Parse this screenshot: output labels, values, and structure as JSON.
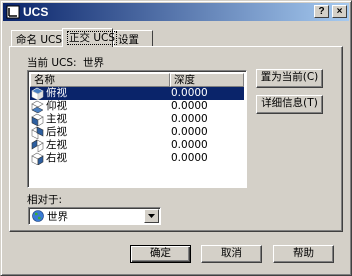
{
  "window": {
    "title": "UCS",
    "help_button": "?",
    "close_button": "×"
  },
  "tabs": [
    {
      "label": "命名 UCS"
    },
    {
      "label": "正交 UCS"
    },
    {
      "label": "设置"
    }
  ],
  "current_ucs": {
    "label": "当前 UCS:",
    "value": "世界"
  },
  "list": {
    "columns": {
      "name": "名称",
      "depth": "深度"
    },
    "rows": [
      {
        "name": "俯视",
        "depth": "0.0000",
        "icon": "top-view-icon"
      },
      {
        "name": "仰视",
        "depth": "0.0000",
        "icon": "bottom-view-icon"
      },
      {
        "name": "主视",
        "depth": "0.0000",
        "icon": "front-view-icon"
      },
      {
        "name": "后视",
        "depth": "0.0000",
        "icon": "back-view-icon"
      },
      {
        "name": "左视",
        "depth": "0.0000",
        "icon": "left-view-icon"
      },
      {
        "name": "右视",
        "depth": "0.0000",
        "icon": "right-view-icon"
      }
    ]
  },
  "side_buttons": {
    "set_current": "置为当前(C)",
    "details": "详细信息(T)"
  },
  "relative_to": {
    "label": "相对于:",
    "value": "世界"
  },
  "footer": {
    "ok": "确定",
    "cancel": "取消",
    "help": "帮助"
  },
  "colors": {
    "title_start": "#0a246a",
    "title_end": "#a6caf0",
    "selection": "#0a246a",
    "face": "#d4d0c8"
  }
}
